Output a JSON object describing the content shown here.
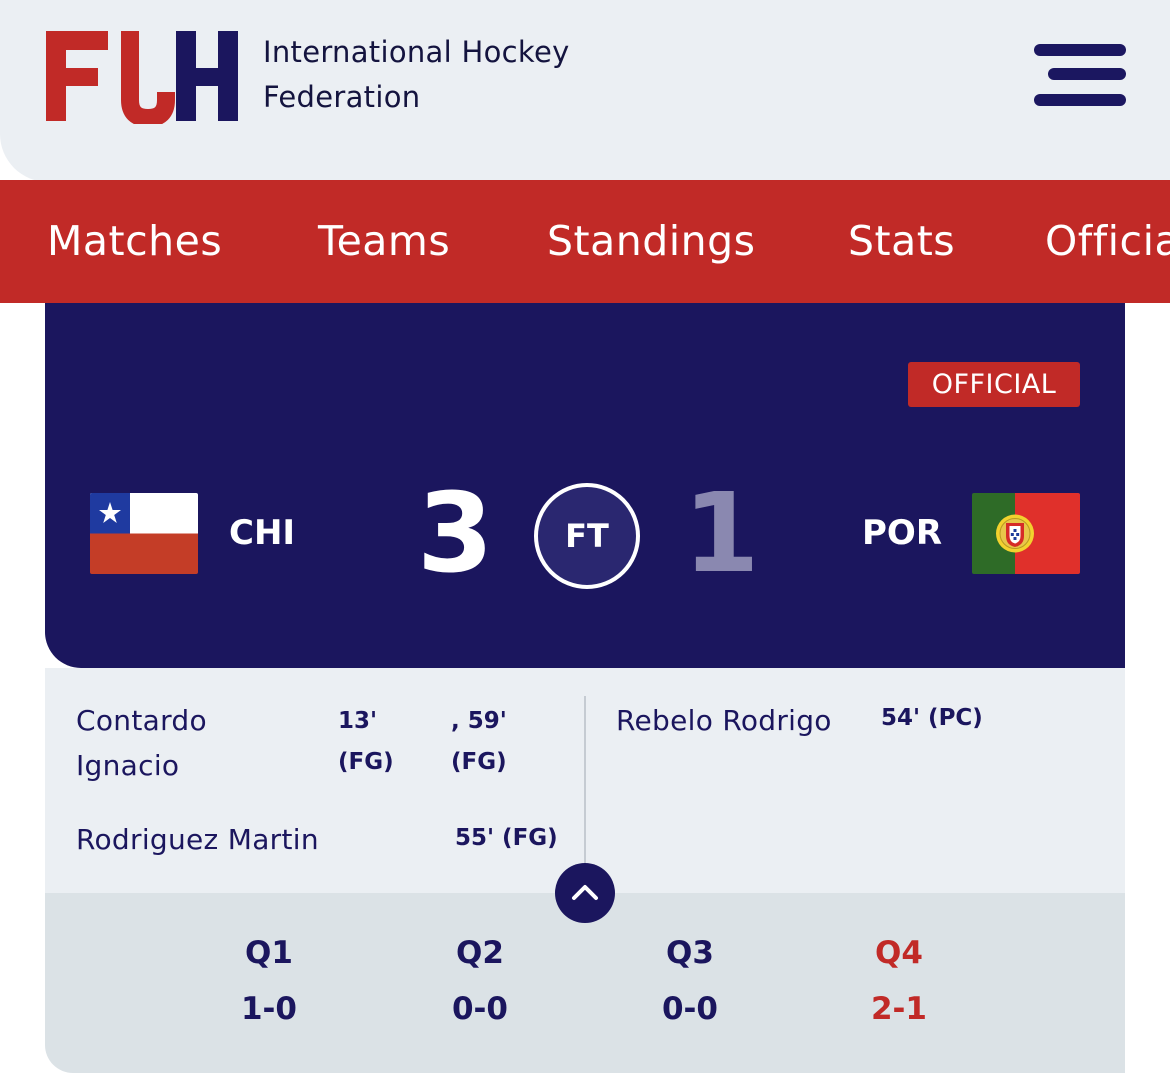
{
  "header": {
    "federation_line1": "International Hockey",
    "federation_line2": "Federation",
    "logo_letters": "FIH"
  },
  "nav": {
    "items": [
      "Matches",
      "Teams",
      "Standings",
      "Stats",
      "Officials"
    ]
  },
  "match": {
    "status_badge": "OFFICIAL",
    "period": "FT",
    "home": {
      "code": "CHI",
      "score": "3",
      "flag": "chile-flag"
    },
    "away": {
      "code": "POR",
      "score": "1",
      "flag": "portugal-flag"
    }
  },
  "scorers": {
    "home": [
      {
        "name_line1": "Contardo",
        "name_line2": "Ignacio",
        "goal1_a": "13'",
        "goal1_b": "(FG)",
        "goal2_a": ", 59'",
        "goal2_b": "(FG)"
      },
      {
        "name": "Rodriguez Martin",
        "goal": "55' (FG)"
      }
    ],
    "away": [
      {
        "name": "Rebelo Rodrigo",
        "goal": "54' (PC)"
      }
    ]
  },
  "quarters": [
    {
      "label": "Q1",
      "score": "1-0"
    },
    {
      "label": "Q2",
      "score": "0-0"
    },
    {
      "label": "Q3",
      "score": "0-0"
    },
    {
      "label": "Q4",
      "score": "2-1"
    }
  ],
  "colors": {
    "navy": "#1b165e",
    "red": "#c12a27",
    "light_bg": "#ebeff3",
    "away_score_muted": "#8a88b0"
  }
}
